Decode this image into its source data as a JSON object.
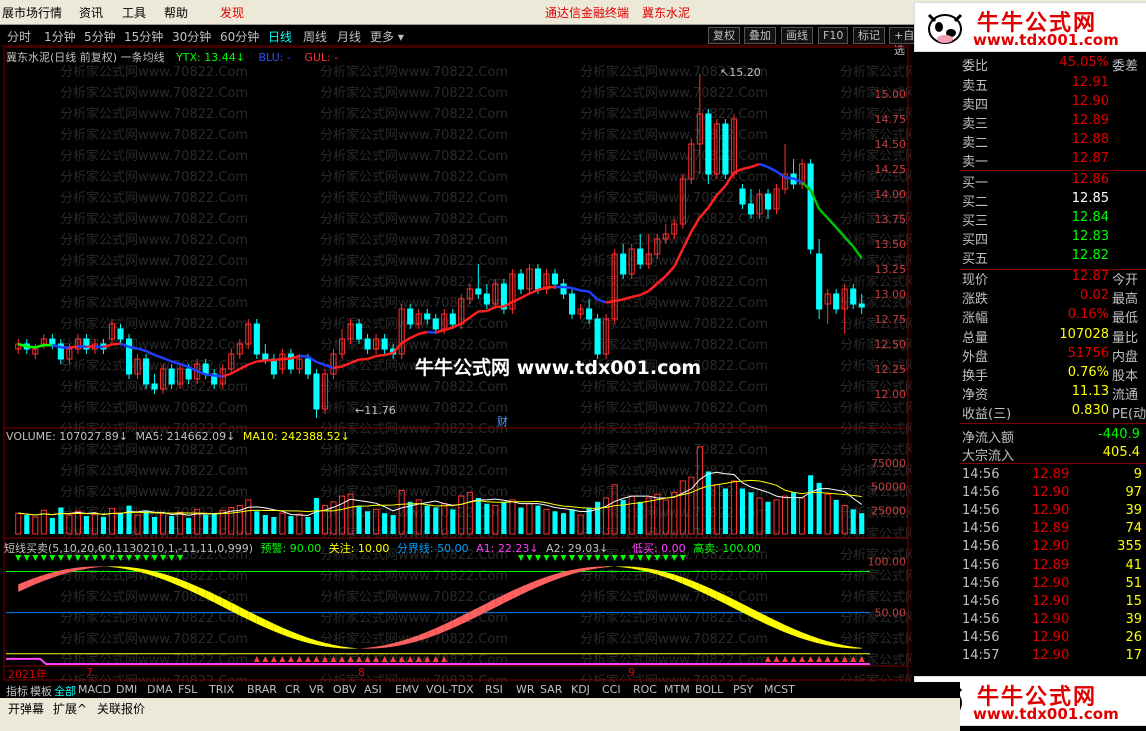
{
  "menubar": {
    "items": [
      "展市场行情",
      "资讯",
      "工具",
      "帮助"
    ],
    "discover": "发现",
    "terminal": "通达信金融终端",
    "stock": "冀东水泥"
  },
  "periods": [
    "分时",
    "1分钟",
    "5分钟",
    "15分钟",
    "30分钟",
    "60分钟",
    "日线",
    "周线",
    "月线",
    "更多"
  ],
  "active_period": "日线",
  "more_arrow": "▾",
  "right_buttons": [
    "复权",
    "叠加",
    "画线",
    "F10",
    "标记",
    "+自选"
  ],
  "main": {
    "title": "冀东水泥(日线 前复权) 一条均线",
    "ytx": "YTX: 13.44",
    "ytx_arrow": "↓",
    "blu": "BLU: -",
    "gul": "GUL: -",
    "high_label": "15.20",
    "low_label": "11.76",
    "cai": "财"
  },
  "price_axis": [
    "15.00",
    "14.75",
    "14.50",
    "14.25",
    "14.00",
    "13.75",
    "13.50",
    "13.25",
    "13.00",
    "12.75",
    "12.50",
    "12.25",
    "12.00"
  ],
  "volume": {
    "label": "VOLUME: 107027.89",
    "ma5": "MA5: 214662.09",
    "ma10": "MA10: 242388.52",
    "axis": [
      "75000",
      "50000",
      "25000"
    ]
  },
  "indicator": {
    "label": "短线买卖(5,10,20,60,1130210,1,-11,11,0,999)",
    "yj": "预警: 90.00",
    "gz": "关注: 10.00",
    "fjx": "分界线: 50.00",
    "a1": "A1: 22.23",
    "a2": "A2: 29.03",
    "dm": "低买: 0.00",
    "gm": "高卖: 100.00",
    "axis": [
      "100.00",
      "50.00"
    ]
  },
  "date_labels": [
    "2021年",
    "7",
    "8",
    "9"
  ],
  "watermark_text": "牛牛公式网  www.tdx001.com",
  "bg_watermark": "分析家公式网www.70822.Com",
  "quote": {
    "ratio_label": "委比",
    "ratio_value": "45.05%",
    "diff_label": "委差",
    "sell": [
      {
        "label": "卖五",
        "price": "12.91"
      },
      {
        "label": "卖四",
        "price": "12.90"
      },
      {
        "label": "卖三",
        "price": "12.89"
      },
      {
        "label": "卖二",
        "price": "12.88"
      },
      {
        "label": "卖一",
        "price": "12.87"
      }
    ],
    "buy": [
      {
        "label": "买一",
        "price": "12.86"
      },
      {
        "label": "买二",
        "price": "12.85"
      },
      {
        "label": "买三",
        "price": "12.84"
      },
      {
        "label": "买四",
        "price": "12.83"
      },
      {
        "label": "买五",
        "price": "12.82"
      }
    ],
    "stats": [
      {
        "l": "现价",
        "v": "12.87",
        "r": "今开"
      },
      {
        "l": "涨跌",
        "v": "0.02",
        "r": "最高"
      },
      {
        "l": "涨幅",
        "v": "0.16%",
        "r": "最低"
      },
      {
        "l": "总量",
        "v": "107028",
        "r": "量比"
      },
      {
        "l": "外盘",
        "v": "51756",
        "r": "内盘"
      },
      {
        "l": "换手",
        "v": "0.76%",
        "r": "股本"
      },
      {
        "l": "净资",
        "v": "11.13",
        "r": "流通"
      },
      {
        "l": "收益(三)",
        "v": "0.830",
        "r": "PE(动)"
      }
    ],
    "inflow_label": "净流入额",
    "inflow_value": "-440.9",
    "big_label": "大宗流入",
    "big_value": "405.4",
    "ticks": [
      {
        "t": "14:56",
        "p": "12.89",
        "v": "9"
      },
      {
        "t": "14:56",
        "p": "12.90",
        "v": "97"
      },
      {
        "t": "14:56",
        "p": "12.90",
        "v": "39"
      },
      {
        "t": "14:56",
        "p": "12.89",
        "v": "74"
      },
      {
        "t": "14:56",
        "p": "12.90",
        "v": "355"
      },
      {
        "t": "14:56",
        "p": "12.89",
        "v": "41"
      },
      {
        "t": "14:56",
        "p": "12.90",
        "v": "51"
      },
      {
        "t": "14:56",
        "p": "12.90",
        "v": "15"
      },
      {
        "t": "14:56",
        "p": "12.90",
        "v": "39"
      },
      {
        "t": "14:56",
        "p": "12.90",
        "v": "26"
      },
      {
        "t": "14:57",
        "p": "12.90",
        "v": "17"
      }
    ]
  },
  "tabs": [
    "指标",
    "模板",
    "全部",
    "MACD",
    "DMI",
    "DMA",
    "FSL",
    "TRIX",
    "BRAR",
    "CR",
    "VR",
    "OBV",
    "ASI",
    "EMV",
    "VOL-TDX",
    "RSI",
    "WR",
    "SAR",
    "KDJ",
    "CCI",
    "ROC",
    "MTM",
    "BOLL",
    "PSY",
    "MCST"
  ],
  "bottom": [
    "开弹幕",
    "扩展^",
    "关联报价"
  ],
  "logo": {
    "line1": "牛牛公式网",
    "line2": "www.tdx001.com"
  },
  "chart_data": {
    "type": "candlestick",
    "ylim": [
      11.7,
      15.3
    ],
    "candles": [
      [
        12.45,
        12.5,
        12.4,
        12.55
      ],
      [
        12.5,
        12.45,
        12.4,
        12.55
      ],
      [
        12.4,
        12.45,
        12.35,
        12.5
      ],
      [
        12.5,
        12.55,
        12.45,
        12.6
      ],
      [
        12.55,
        12.5,
        12.45,
        12.6
      ],
      [
        12.5,
        12.35,
        12.3,
        12.55
      ],
      [
        12.35,
        12.45,
        12.3,
        12.5
      ],
      [
        12.45,
        12.55,
        12.4,
        12.6
      ],
      [
        12.55,
        12.45,
        12.4,
        12.6
      ],
      [
        12.45,
        12.5,
        12.4,
        12.55
      ],
      [
        12.5,
        12.45,
        12.4,
        12.55
      ],
      [
        12.55,
        12.7,
        12.5,
        12.75
      ],
      [
        12.65,
        12.55,
        12.5,
        12.7
      ],
      [
        12.55,
        12.2,
        12.15,
        12.6
      ],
      [
        12.2,
        12.35,
        12.15,
        12.4
      ],
      [
        12.35,
        12.1,
        12.05,
        12.4
      ],
      [
        12.1,
        12.05,
        12.0,
        12.2
      ],
      [
        12.05,
        12.25,
        12.0,
        12.3
      ],
      [
        12.25,
        12.1,
        12.05,
        12.3
      ],
      [
        12.1,
        12.25,
        12.05,
        12.3
      ],
      [
        12.25,
        12.15,
        12.1,
        12.3
      ],
      [
        12.15,
        12.3,
        12.1,
        12.35
      ],
      [
        12.3,
        12.2,
        12.15,
        12.35
      ],
      [
        12.2,
        12.1,
        12.05,
        12.25
      ],
      [
        12.1,
        12.25,
        12.05,
        12.3
      ],
      [
        12.25,
        12.4,
        12.2,
        12.45
      ],
      [
        12.4,
        12.5,
        12.35,
        12.55
      ],
      [
        12.5,
        12.7,
        12.45,
        12.75
      ],
      [
        12.7,
        12.4,
        12.35,
        12.75
      ],
      [
        12.4,
        12.35,
        12.3,
        12.5
      ],
      [
        12.35,
        12.2,
        12.15,
        12.4
      ],
      [
        12.25,
        12.4,
        12.2,
        12.45
      ],
      [
        12.4,
        12.25,
        12.2,
        12.45
      ],
      [
        12.25,
        12.35,
        12.2,
        12.4
      ],
      [
        12.35,
        12.2,
        12.15,
        12.4
      ],
      [
        12.2,
        11.85,
        11.76,
        12.25
      ],
      [
        11.85,
        12.2,
        11.8,
        12.25
      ],
      [
        12.2,
        12.4,
        12.15,
        12.45
      ],
      [
        12.4,
        12.55,
        12.35,
        12.65
      ],
      [
        12.55,
        12.7,
        12.5,
        12.75
      ],
      [
        12.7,
        12.55,
        12.5,
        12.75
      ],
      [
        12.55,
        12.45,
        12.4,
        12.6
      ],
      [
        12.45,
        12.55,
        12.4,
        12.6
      ],
      [
        12.55,
        12.45,
        12.4,
        12.6
      ],
      [
        12.45,
        12.4,
        12.35,
        12.5
      ],
      [
        12.4,
        12.85,
        12.35,
        12.9
      ],
      [
        12.85,
        12.7,
        12.65,
        12.9
      ],
      [
        12.7,
        12.8,
        12.65,
        12.85
      ],
      [
        12.8,
        12.75,
        12.7,
        12.85
      ],
      [
        12.75,
        12.65,
        12.6,
        12.8
      ],
      [
        12.65,
        12.8,
        12.6,
        12.85
      ],
      [
        12.8,
        12.7,
        12.65,
        12.85
      ],
      [
        12.7,
        12.95,
        12.65,
        13.0
      ],
      [
        12.95,
        13.05,
        12.9,
        13.1
      ],
      [
        13.05,
        13.0,
        12.95,
        13.3
      ],
      [
        13.0,
        12.9,
        12.85,
        13.1
      ],
      [
        12.9,
        13.1,
        12.85,
        13.15
      ],
      [
        13.1,
        12.85,
        12.8,
        13.15
      ],
      [
        12.85,
        13.2,
        12.8,
        13.25
      ],
      [
        13.2,
        13.05,
        13.0,
        13.25
      ],
      [
        13.05,
        13.25,
        13.0,
        13.3
      ],
      [
        13.25,
        13.05,
        13.0,
        13.3
      ],
      [
        13.05,
        13.2,
        13.0,
        13.25
      ],
      [
        13.2,
        13.1,
        13.05,
        13.25
      ],
      [
        13.1,
        13.0,
        12.95,
        13.15
      ],
      [
        13.0,
        12.8,
        12.75,
        13.05
      ],
      [
        12.8,
        12.85,
        12.75,
        12.9
      ],
      [
        12.85,
        12.75,
        12.7,
        12.95
      ],
      [
        12.75,
        12.4,
        12.35,
        12.8
      ],
      [
        12.4,
        12.75,
        12.35,
        12.8
      ],
      [
        12.75,
        13.4,
        12.7,
        13.45
      ],
      [
        13.4,
        13.2,
        13.15,
        13.5
      ],
      [
        13.2,
        13.45,
        13.15,
        13.5
      ],
      [
        13.45,
        13.3,
        13.25,
        13.6
      ],
      [
        13.3,
        13.4,
        13.25,
        13.6
      ],
      [
        13.4,
        13.55,
        13.35,
        13.6
      ],
      [
        13.55,
        13.6,
        13.5,
        13.7
      ],
      [
        13.6,
        13.7,
        13.55,
        13.75
      ],
      [
        13.7,
        14.15,
        13.65,
        14.2
      ],
      [
        14.15,
        14.5,
        14.1,
        14.55
      ],
      [
        14.5,
        14.8,
        14.2,
        15.2
      ],
      [
        14.8,
        14.2,
        14.1,
        14.85
      ],
      [
        14.2,
        14.7,
        14.15,
        14.75
      ],
      [
        14.7,
        14.2,
        14.15,
        14.75
      ],
      [
        14.2,
        14.75,
        14.15,
        14.8
      ],
      [
        14.05,
        13.9,
        13.85,
        14.1
      ],
      [
        13.9,
        13.8,
        13.75,
        14.05
      ],
      [
        13.8,
        14.0,
        13.75,
        14.05
      ],
      [
        14.0,
        13.85,
        13.75,
        14.05
      ],
      [
        13.85,
        14.05,
        13.8,
        14.1
      ],
      [
        14.05,
        14.2,
        14.0,
        14.5
      ],
      [
        14.2,
        14.1,
        14.05,
        14.35
      ],
      [
        14.1,
        14.3,
        14.05,
        14.35
      ],
      [
        14.3,
        13.45,
        13.4,
        14.35
      ],
      [
        13.4,
        12.85,
        12.75,
        13.55
      ],
      [
        12.9,
        13.0,
        12.7,
        13.05
      ],
      [
        13.0,
        12.85,
        12.8,
        13.05
      ],
      [
        12.85,
        13.05,
        12.6,
        13.1
      ],
      [
        13.05,
        12.9,
        12.85,
        13.1
      ],
      [
        12.9,
        12.87,
        12.8,
        13.0
      ]
    ],
    "volume": [
      22000,
      20000,
      18000,
      25000,
      17000,
      28000,
      20000,
      24000,
      19000,
      21000,
      18000,
      27000,
      22000,
      30000,
      20000,
      24000,
      18000,
      22000,
      19000,
      23000,
      17000,
      26000,
      20000,
      22000,
      25000,
      28000,
      30000,
      36000,
      24000,
      20000,
      18000,
      22000,
      19000,
      21000,
      18000,
      38000,
      30000,
      34000,
      40000,
      42000,
      30000,
      24000,
      26000,
      22000,
      20000,
      46000,
      34000,
      36000,
      30000,
      28000,
      32000,
      26000,
      40000,
      44000,
      38000,
      32000,
      30000,
      34000,
      36000,
      28000,
      32000,
      30000,
      26000,
      24000,
      22000,
      26000,
      20000,
      28000,
      34000,
      38000,
      52000,
      36000,
      40000,
      34000,
      38000,
      42000,
      36000,
      44000,
      56000,
      60000,
      92000,
      66000,
      52000,
      48000,
      56000,
      48000,
      44000,
      38000,
      34000,
      36000,
      40000,
      44000,
      38000,
      62000,
      54000,
      42000,
      36000,
      30000,
      26000,
      22000
    ],
    "vol_ylim": [
      0,
      95000
    ],
    "indicator_ylim": [
      0,
      110
    ],
    "indicator_lines": {
      "yj": 90,
      "fjx": 50,
      "gz": 10
    }
  }
}
